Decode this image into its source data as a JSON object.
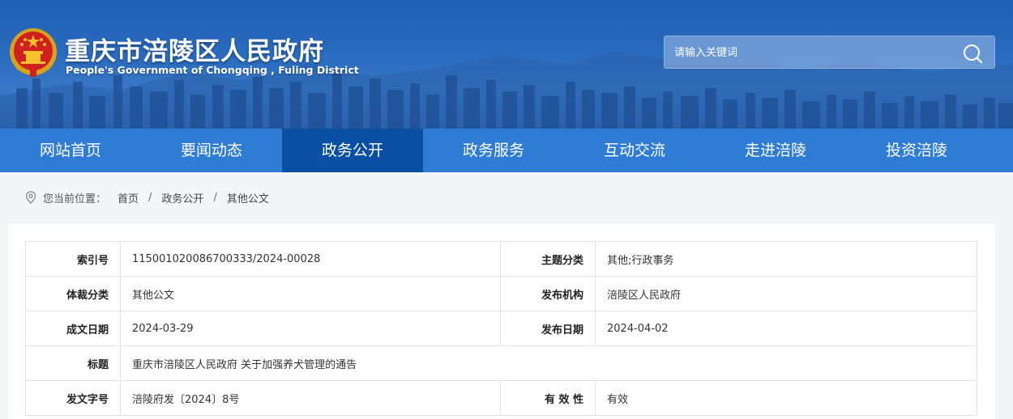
{
  "header": {
    "title": "重庆市涪陵区人民政府",
    "subtitle": "People's Government of Chongqing , Fuling District",
    "emblem_icon": "national-emblem-icon",
    "search": {
      "placeholder": "请输入关键词",
      "button_icon": "search-icon"
    }
  },
  "nav": {
    "items": [
      {
        "label": "网站首页"
      },
      {
        "label": "要闻动态"
      },
      {
        "label": "政务公开"
      },
      {
        "label": "政务服务"
      },
      {
        "label": "互动交流"
      },
      {
        "label": "走进涪陵"
      },
      {
        "label": "投资涪陵"
      }
    ],
    "active_index": 2,
    "color": "#2f7cd4",
    "active_color": "#0a4fa3"
  },
  "breadcrumb": {
    "icon": "location-icon",
    "prefix": "您当前位置：",
    "items": [
      "首页",
      "政务公开",
      "其他公文"
    ],
    "separator": "/"
  },
  "meta": {
    "rows": [
      {
        "label1": "索引号",
        "value1": "11500102008670033 3/2024-00028",
        "label2": "主题分类",
        "value2": "其他;行政事务"
      },
      {
        "label1": "体裁分类",
        "value1": "其他公文",
        "label2": "发布机构",
        "value2": "涪陵区人民政府"
      },
      {
        "label1": "成文日期",
        "value1": "2024-03-29",
        "label2": "发布日期",
        "value2": "2024-04-02"
      },
      {
        "label1": "标题",
        "value1": "重庆市涪陵区人民政府 关于加强养犬管理的通告"
      },
      {
        "label1": "发文字号",
        "value1": "涪陵府发〔2024〕8号",
        "label2": "有 效 性",
        "value2": "有效"
      }
    ]
  }
}
